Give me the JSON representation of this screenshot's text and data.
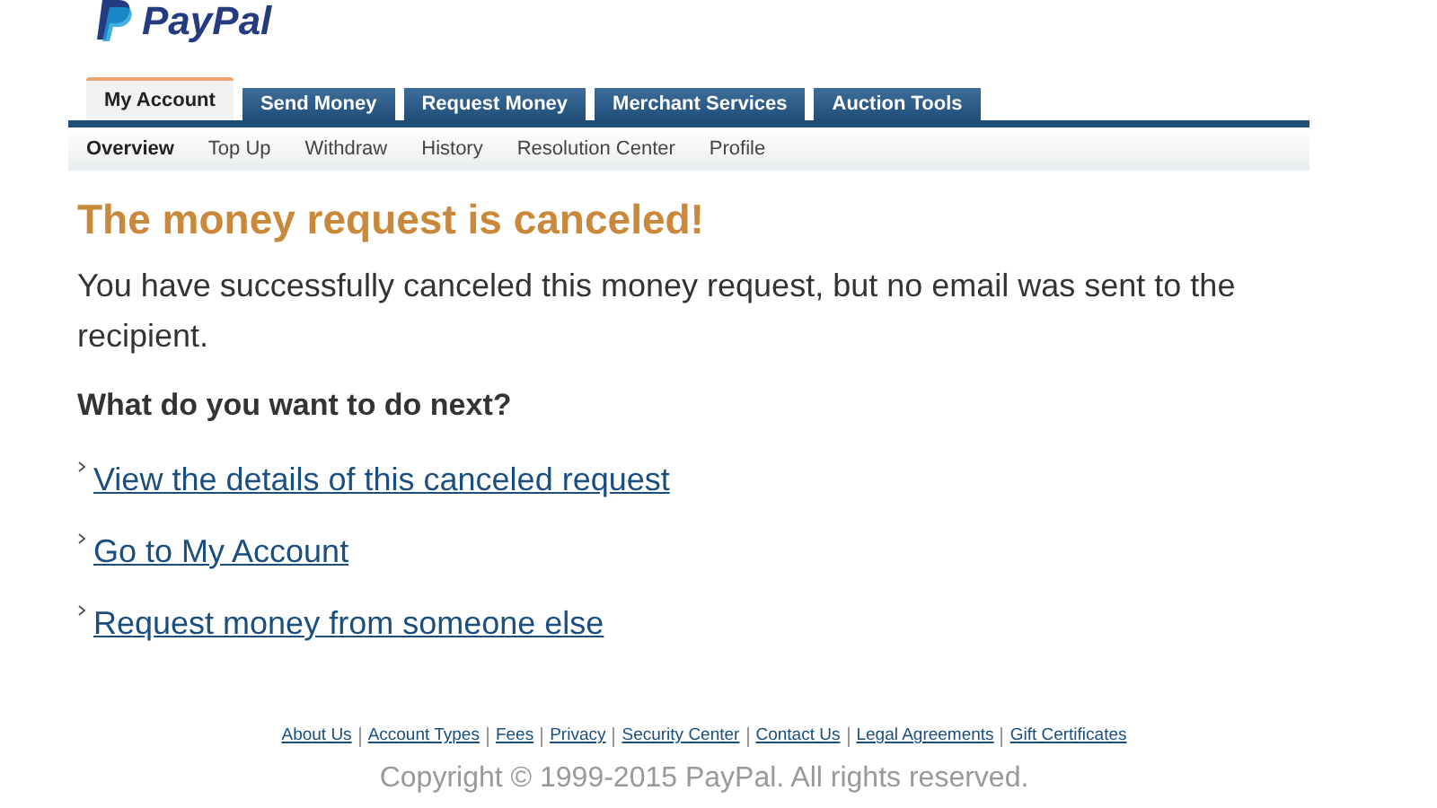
{
  "logo": {
    "text": "PayPal"
  },
  "tabs": [
    {
      "label": "My Account",
      "selected": true
    },
    {
      "label": "Send Money",
      "selected": false
    },
    {
      "label": "Request Money",
      "selected": false
    },
    {
      "label": "Merchant Services",
      "selected": false
    },
    {
      "label": "Auction Tools",
      "selected": false
    }
  ],
  "subnav": [
    {
      "label": "Overview",
      "selected": true
    },
    {
      "label": "Top Up",
      "selected": false
    },
    {
      "label": "Withdraw",
      "selected": false
    },
    {
      "label": "History",
      "selected": false
    },
    {
      "label": "Resolution Center",
      "selected": false
    },
    {
      "label": "Profile",
      "selected": false
    }
  ],
  "heading": "The money request is canceled!",
  "message": "You have successfully canceled this money request, but no email was sent to the recipient.",
  "next_heading": "What do you want to do next?",
  "next_links": [
    "View the details of this canceled request",
    "Go to My Account",
    "Request money from someone else"
  ],
  "footer": {
    "links": [
      "About Us",
      "Account Types",
      "Fees",
      "Privacy",
      "Security Center",
      "Contact Us",
      "Legal Agreements",
      "Gift Certificates"
    ],
    "copyright": "Copyright © 1999-2015 PayPal. All rights reserved."
  }
}
